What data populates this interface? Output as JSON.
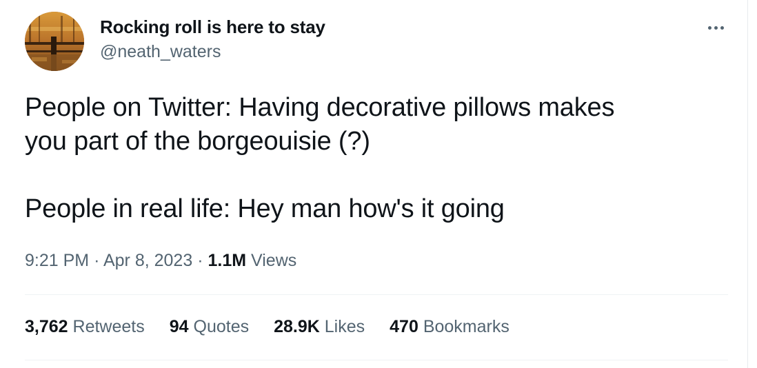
{
  "tweet": {
    "author": {
      "display_name": "Rocking roll is here to stay",
      "handle": "@neath_waters"
    },
    "text_lines": [
      "People on Twitter: Having decorative pillows makes",
      "you part of the borgeouisie (?)",
      "People in real life: Hey man how's it going"
    ],
    "time": "9:21 PM",
    "date": "Apr 8, 2023",
    "separator": "·",
    "views_count": "1.1M",
    "views_label": "Views",
    "stats": {
      "retweets": {
        "count": "3,762",
        "label": "Retweets"
      },
      "quotes": {
        "count": "94",
        "label": "Quotes"
      },
      "likes": {
        "count": "28.9K",
        "label": "Likes"
      },
      "bookmarks": {
        "count": "470",
        "label": "Bookmarks"
      }
    }
  },
  "icons": {
    "more": "more-horizontal-icon"
  },
  "colors": {
    "primary_text": "#0f1419",
    "secondary_text": "#536471",
    "divider": "#eff3f4"
  }
}
